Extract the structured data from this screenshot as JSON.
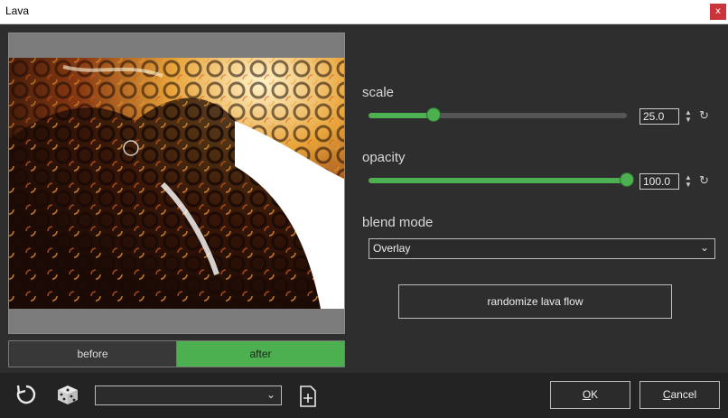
{
  "window": {
    "title": "Lava",
    "close_glyph": "x"
  },
  "preview": {
    "toggle_before": "before",
    "toggle_after": "after",
    "active": "after"
  },
  "scale": {
    "label": "scale",
    "value": "25.0",
    "fraction": 0.25
  },
  "opacity": {
    "label": "opacity",
    "value": "100.0",
    "fraction": 1.0
  },
  "blend": {
    "label": "blend mode",
    "value": "Overlay"
  },
  "randomize": {
    "label": "randomize lava flow"
  },
  "footer": {
    "preset_value": "",
    "ok_prefix": "",
    "ok_underlined": "O",
    "ok_rest": "K",
    "cancel_underlined": "C",
    "cancel_rest": "ancel"
  },
  "colors": {
    "accent": "#4caf50",
    "bg": "#2e2e2e",
    "bottom_bg": "#232323"
  },
  "icons": {
    "reset": "reset-icon",
    "dice": "dice-icon",
    "add_preset": "add-preset-icon",
    "spin": "spinner-arrows-icon",
    "chevron": "chevron-down-icon"
  }
}
